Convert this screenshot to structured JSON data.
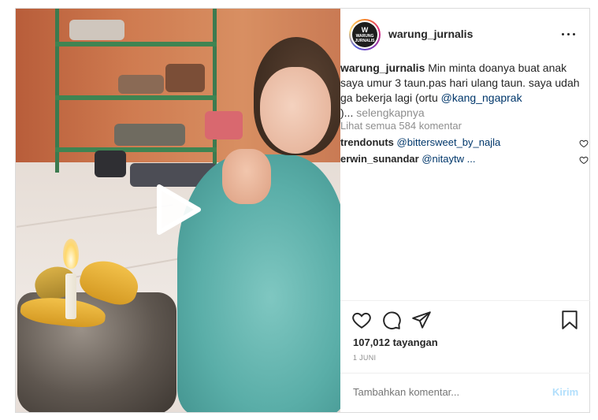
{
  "post": {
    "username": "warung_jurnalis",
    "avatar_text": {
      "mark": "W",
      "line1": "WARUNG",
      "line2": "JURNALIS"
    },
    "caption": {
      "username": "warung_jurnalis",
      "text": "Min minta doanya  buat anak saya umur 3 taun.pas hari ulang taun. saya udah ga bekerja lagi (ortu ",
      "mention": "@kang_ngaprak",
      "tail": ")...",
      "more_label": "selengkapnya"
    },
    "view_all_comments": "Lihat semua 584 komentar",
    "comments": [
      {
        "username": "trendonuts",
        "mention": "@bittersweet_by_najla"
      },
      {
        "username": "erwin_sunandar",
        "mention": "@nitaytw ..."
      }
    ],
    "views": "107,012 tayangan",
    "date": "1 JUNI",
    "add_comment_placeholder": "Tambahkan komentar...",
    "post_button": "Kirim"
  },
  "icons": {
    "more": "more-options-icon",
    "like": "heart-icon",
    "comment": "comment-icon",
    "share": "paper-plane-icon",
    "save": "bookmark-icon",
    "play": "play-icon"
  },
  "colors": {
    "mention": "#00376b",
    "muted": "#8e8e8e",
    "post_button_disabled": "#b2dffc",
    "border": "#dbdbdb"
  }
}
